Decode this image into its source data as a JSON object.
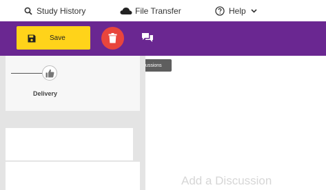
{
  "nav": {
    "study_history": "Study History",
    "file_transfer": "File Transfer",
    "help": "Help"
  },
  "toolbar": {
    "save_label": "Save",
    "discussion_tooltip": "Discussions"
  },
  "stage": {
    "label": "Delivery"
  },
  "discussion": {
    "add_label": "Add a Discussion"
  },
  "colors": {
    "toolbar": "#6a2791",
    "save_button": "#ffd31a",
    "delete_button": "#e8453c",
    "left_panel": "#e4e4e4"
  },
  "icons": [
    "search-icon",
    "cloud-icon",
    "help-circle-icon",
    "chevron-down-icon",
    "floppy-disk-icon",
    "trash-icon",
    "chat-bubbles-icon",
    "thumbs-up-icon"
  ]
}
